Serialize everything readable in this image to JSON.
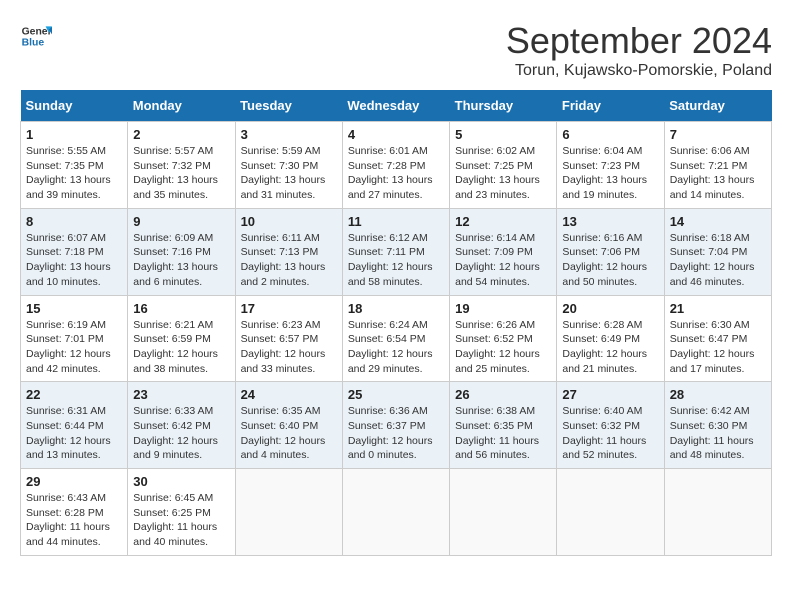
{
  "header": {
    "logo_line1": "General",
    "logo_line2": "Blue",
    "title": "September 2024",
    "subtitle": "Torun, Kujawsko-Pomorskie, Poland"
  },
  "calendar": {
    "days_of_week": [
      "Sunday",
      "Monday",
      "Tuesday",
      "Wednesday",
      "Thursday",
      "Friday",
      "Saturday"
    ],
    "weeks": [
      [
        {
          "day": "",
          "info": ""
        },
        {
          "day": "2",
          "info": "Sunrise: 5:57 AM\nSunset: 7:32 PM\nDaylight: 13 hours\nand 35 minutes."
        },
        {
          "day": "3",
          "info": "Sunrise: 5:59 AM\nSunset: 7:30 PM\nDaylight: 13 hours\nand 31 minutes."
        },
        {
          "day": "4",
          "info": "Sunrise: 6:01 AM\nSunset: 7:28 PM\nDaylight: 13 hours\nand 27 minutes."
        },
        {
          "day": "5",
          "info": "Sunrise: 6:02 AM\nSunset: 7:25 PM\nDaylight: 13 hours\nand 23 minutes."
        },
        {
          "day": "6",
          "info": "Sunrise: 6:04 AM\nSunset: 7:23 PM\nDaylight: 13 hours\nand 19 minutes."
        },
        {
          "day": "7",
          "info": "Sunrise: 6:06 AM\nSunset: 7:21 PM\nDaylight: 13 hours\nand 14 minutes."
        }
      ],
      [
        {
          "day": "1",
          "info": "Sunrise: 5:55 AM\nSunset: 7:35 PM\nDaylight: 13 hours\nand 39 minutes."
        },
        {
          "day": "",
          "info": ""
        },
        {
          "day": "",
          "info": ""
        },
        {
          "day": "",
          "info": ""
        },
        {
          "day": "",
          "info": ""
        },
        {
          "day": "",
          "info": ""
        },
        {
          "day": "",
          "info": ""
        }
      ],
      [
        {
          "day": "8",
          "info": "Sunrise: 6:07 AM\nSunset: 7:18 PM\nDaylight: 13 hours\nand 10 minutes."
        },
        {
          "day": "9",
          "info": "Sunrise: 6:09 AM\nSunset: 7:16 PM\nDaylight: 13 hours\nand 6 minutes."
        },
        {
          "day": "10",
          "info": "Sunrise: 6:11 AM\nSunset: 7:13 PM\nDaylight: 13 hours\nand 2 minutes."
        },
        {
          "day": "11",
          "info": "Sunrise: 6:12 AM\nSunset: 7:11 PM\nDaylight: 12 hours\nand 58 minutes."
        },
        {
          "day": "12",
          "info": "Sunrise: 6:14 AM\nSunset: 7:09 PM\nDaylight: 12 hours\nand 54 minutes."
        },
        {
          "day": "13",
          "info": "Sunrise: 6:16 AM\nSunset: 7:06 PM\nDaylight: 12 hours\nand 50 minutes."
        },
        {
          "day": "14",
          "info": "Sunrise: 6:18 AM\nSunset: 7:04 PM\nDaylight: 12 hours\nand 46 minutes."
        }
      ],
      [
        {
          "day": "15",
          "info": "Sunrise: 6:19 AM\nSunset: 7:01 PM\nDaylight: 12 hours\nand 42 minutes."
        },
        {
          "day": "16",
          "info": "Sunrise: 6:21 AM\nSunset: 6:59 PM\nDaylight: 12 hours\nand 38 minutes."
        },
        {
          "day": "17",
          "info": "Sunrise: 6:23 AM\nSunset: 6:57 PM\nDaylight: 12 hours\nand 33 minutes."
        },
        {
          "day": "18",
          "info": "Sunrise: 6:24 AM\nSunset: 6:54 PM\nDaylight: 12 hours\nand 29 minutes."
        },
        {
          "day": "19",
          "info": "Sunrise: 6:26 AM\nSunset: 6:52 PM\nDaylight: 12 hours\nand 25 minutes."
        },
        {
          "day": "20",
          "info": "Sunrise: 6:28 AM\nSunset: 6:49 PM\nDaylight: 12 hours\nand 21 minutes."
        },
        {
          "day": "21",
          "info": "Sunrise: 6:30 AM\nSunset: 6:47 PM\nDaylight: 12 hours\nand 17 minutes."
        }
      ],
      [
        {
          "day": "22",
          "info": "Sunrise: 6:31 AM\nSunset: 6:44 PM\nDaylight: 12 hours\nand 13 minutes."
        },
        {
          "day": "23",
          "info": "Sunrise: 6:33 AM\nSunset: 6:42 PM\nDaylight: 12 hours\nand 9 minutes."
        },
        {
          "day": "24",
          "info": "Sunrise: 6:35 AM\nSunset: 6:40 PM\nDaylight: 12 hours\nand 4 minutes."
        },
        {
          "day": "25",
          "info": "Sunrise: 6:36 AM\nSunset: 6:37 PM\nDaylight: 12 hours\nand 0 minutes."
        },
        {
          "day": "26",
          "info": "Sunrise: 6:38 AM\nSunset: 6:35 PM\nDaylight: 11 hours\nand 56 minutes."
        },
        {
          "day": "27",
          "info": "Sunrise: 6:40 AM\nSunset: 6:32 PM\nDaylight: 11 hours\nand 52 minutes."
        },
        {
          "day": "28",
          "info": "Sunrise: 6:42 AM\nSunset: 6:30 PM\nDaylight: 11 hours\nand 48 minutes."
        }
      ],
      [
        {
          "day": "29",
          "info": "Sunrise: 6:43 AM\nSunset: 6:28 PM\nDaylight: 11 hours\nand 44 minutes."
        },
        {
          "day": "30",
          "info": "Sunrise: 6:45 AM\nSunset: 6:25 PM\nDaylight: 11 hours\nand 40 minutes."
        },
        {
          "day": "",
          "info": ""
        },
        {
          "day": "",
          "info": ""
        },
        {
          "day": "",
          "info": ""
        },
        {
          "day": "",
          "info": ""
        },
        {
          "day": "",
          "info": ""
        }
      ]
    ]
  }
}
